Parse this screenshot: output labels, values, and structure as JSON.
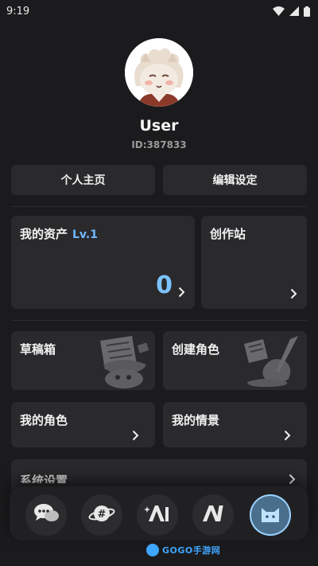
{
  "status": {
    "time": "9:19"
  },
  "profile": {
    "name": "User",
    "id": "ID:387833"
  },
  "buttons": {
    "homepage": "个人主页",
    "edit_settings": "编辑设定"
  },
  "cards": {
    "assets": {
      "title": "我的资产",
      "level": "Lv.1",
      "value": "0"
    },
    "studio": {
      "title": "创作站"
    },
    "drafts": {
      "title": "草稿箱"
    },
    "create_character": {
      "title": "创建角色"
    },
    "my_characters": {
      "title": "我的角色"
    },
    "my_scenes": {
      "title": "我的情景"
    },
    "system_settings": {
      "title": "系统设置"
    }
  },
  "tabs": [
    {
      "icon": "chat-bubbles-icon"
    },
    {
      "icon": "planet-hashtag-icon"
    },
    {
      "icon": "ai-sparkle-icon"
    },
    {
      "icon": "ai-logo-icon"
    },
    {
      "icon": "cat-profile-icon",
      "active": true
    }
  ],
  "watermark": {
    "text": "GOGO手游网"
  },
  "colors": {
    "background": "#1b1b1d",
    "card": "#2a2a2d",
    "accent": "#7cc3ff",
    "level": "#6fb8ff"
  }
}
